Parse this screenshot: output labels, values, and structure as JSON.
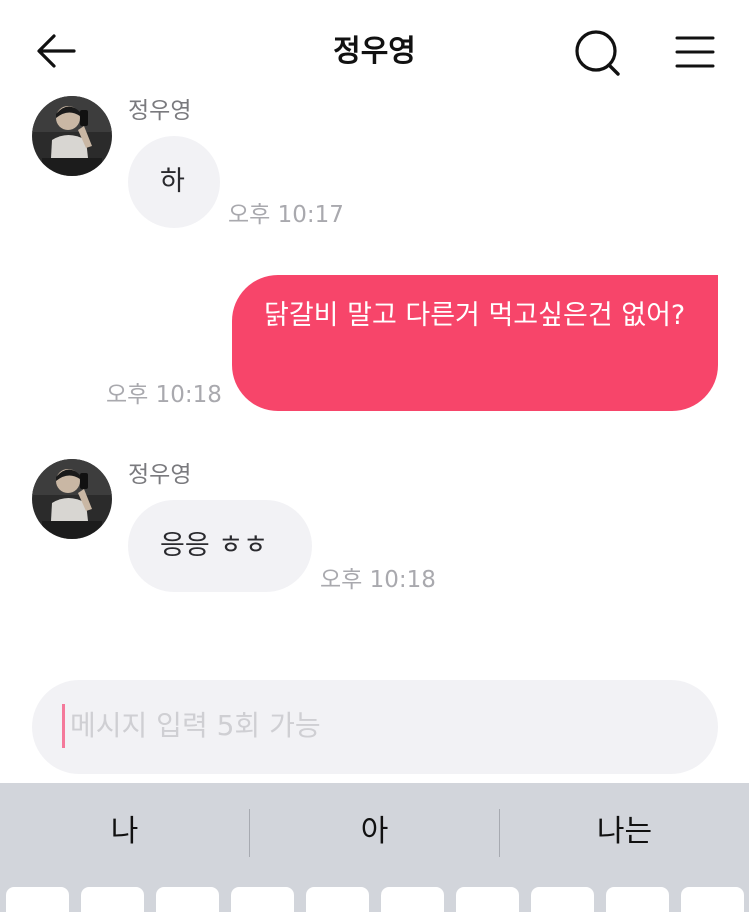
{
  "header": {
    "title": "정우영"
  },
  "messages": [
    {
      "sender": "정우영",
      "text": "하",
      "time": "오후 10:17"
    },
    {
      "text": "닭갈비 말고 다른거 먹고싶은건 없어?",
      "time": "오후 10:18"
    },
    {
      "sender": "정우영",
      "text": "응응 ㅎㅎ",
      "time": "오후 10:18"
    }
  ],
  "input": {
    "placeholder": "메시지 입력 5회 가능"
  },
  "keyboard": {
    "suggestions": [
      "나",
      "아",
      "나는"
    ]
  },
  "colors": {
    "outgoing_bubble": "#f7456a",
    "incoming_bubble": "#f2f2f5",
    "keyboard_bg": "#d2d5db"
  }
}
